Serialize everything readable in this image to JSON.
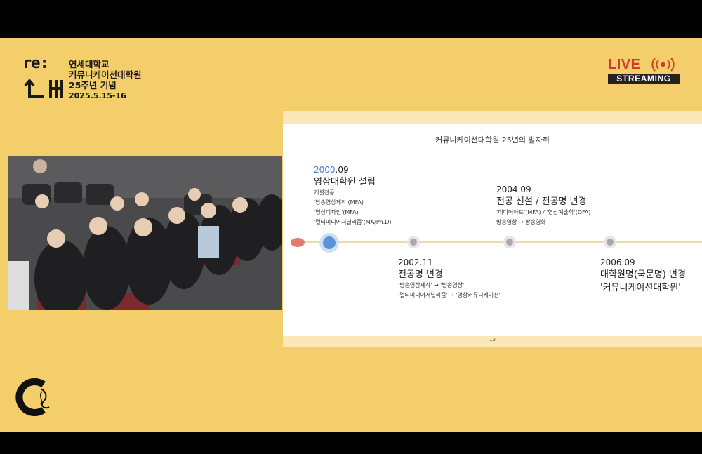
{
  "event": {
    "logo_mark_top": "re:",
    "logo_mark_side": "turn",
    "lines": [
      "연세대학교",
      "커뮤니케이션대학원",
      "25주년 기념",
      "2025.5.15-16"
    ]
  },
  "live": {
    "label": "LIVE",
    "sub": "STREAMING",
    "accent": "#d33a2c"
  },
  "slide": {
    "title": "커뮤니케이션대학원 25년의 발자취",
    "page_number": "13",
    "events": [
      {
        "year_hl": "2000",
        "year_rest": ".09",
        "heading": "영상대학원 설립",
        "details": [
          "개설전공:",
          "'방송영상제작'(MFA)",
          "'영상디자인'(MFA)",
          "'멀티미디어저널리즘'(MA/Ph.D)"
        ]
      },
      {
        "year": "2002.11",
        "heading": "전공명 변경",
        "details": [
          "'방송영상제작' → '방송영상'",
          "'멀티미디어저널리즘' → '영상커뮤니케이션'"
        ]
      },
      {
        "year": "2004.09",
        "heading": "전공 신설 / 전공명 변경",
        "details": [
          "'미디어아트'(MFA) / '영상예술학'(DFA)",
          "방송영상 → 방송영화"
        ]
      },
      {
        "year": "2006.09",
        "heading": "대학원명(국문명) 변경",
        "heading2": "'커뮤니케이션대학원'",
        "details": []
      }
    ]
  },
  "colors": {
    "background": "#f4ce6a",
    "highlight_year": "#3f7fcb"
  }
}
